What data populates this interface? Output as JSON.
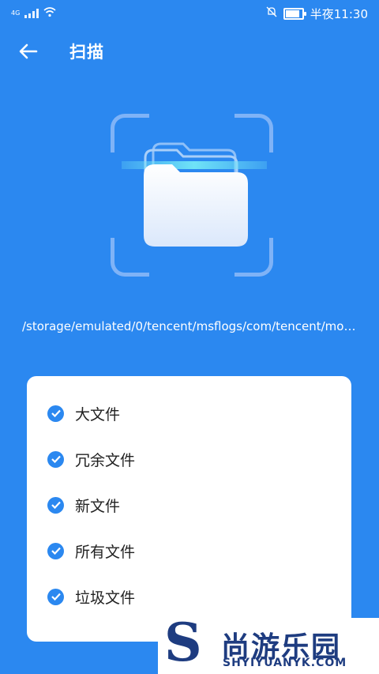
{
  "status_bar": {
    "network": "4G",
    "time": "半夜11:30",
    "battery_level": 0.85
  },
  "header": {
    "back_icon": "back-arrow-icon",
    "title": "扫描"
  },
  "scan": {
    "icon": "folder-icon",
    "current_path": "/storage/emulated/0/tencent/msflogs/com/tencent/mob..."
  },
  "options": [
    {
      "label": "大文件",
      "checked": true
    },
    {
      "label": "冗余文件",
      "checked": true
    },
    {
      "label": "新文件",
      "checked": true
    },
    {
      "label": "所有文件",
      "checked": true
    },
    {
      "label": "垃圾文件",
      "checked": true
    }
  ],
  "watermark": {
    "mark": "S",
    "name": "尚游乐园",
    "url": "SHYIYUANYK.COM"
  },
  "colors": {
    "background": "#2b88f0",
    "card": "#ffffff",
    "check": "#2b88f0",
    "watermark": "#1e3c80"
  }
}
